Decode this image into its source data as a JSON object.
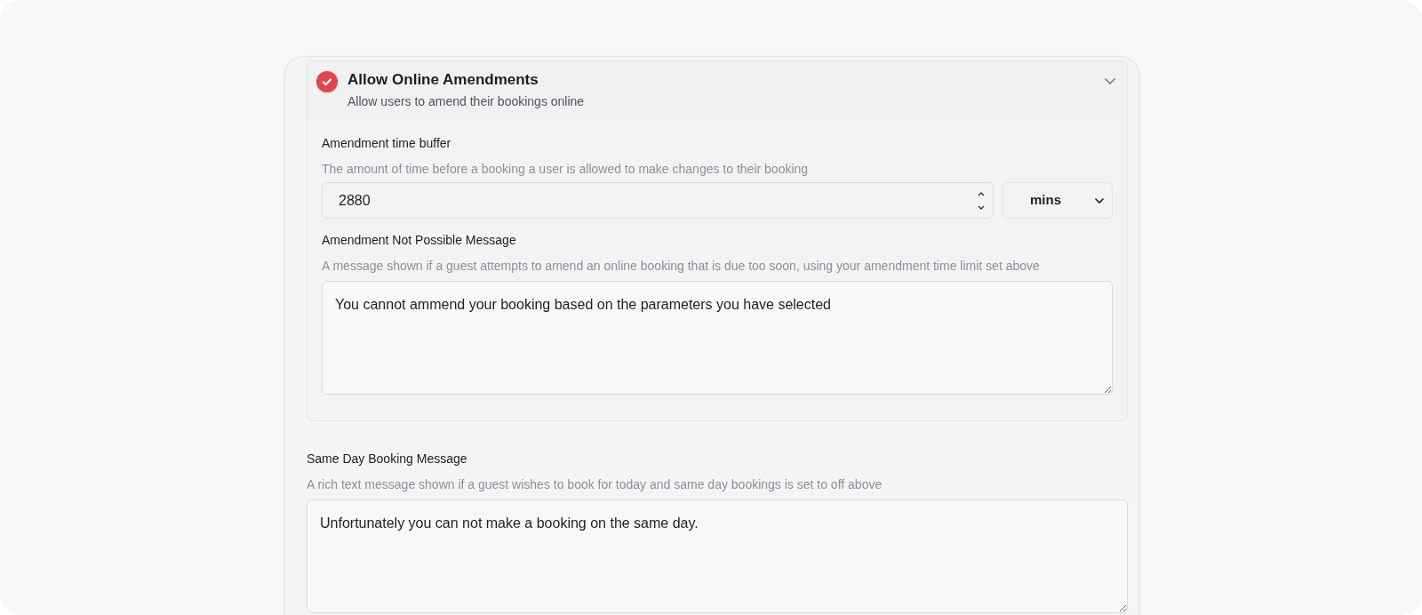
{
  "amendments": {
    "checked": true,
    "expanded": true,
    "title": "Allow Online Amendments",
    "subtitle": "Allow users to amend their bookings online",
    "buffer": {
      "label": "Amendment time buffer",
      "help": "The amount of time before a booking a user is allowed to make changes to their booking",
      "value": "2880",
      "unit": "mins"
    },
    "message": {
      "label": "Amendment Not Possible Message",
      "help": "A message shown if a guest attempts to amend an online booking that is due too soon, using your amendment time limit set above",
      "value": "You cannot ammend your booking based on the parameters you have selected"
    }
  },
  "same_day": {
    "label": "Same Day Booking Message",
    "help": "A rich text message shown if a guest wishes to book for today and same day bookings is set to off above",
    "value": "Unfortunately you can not make a booking on the same day."
  }
}
